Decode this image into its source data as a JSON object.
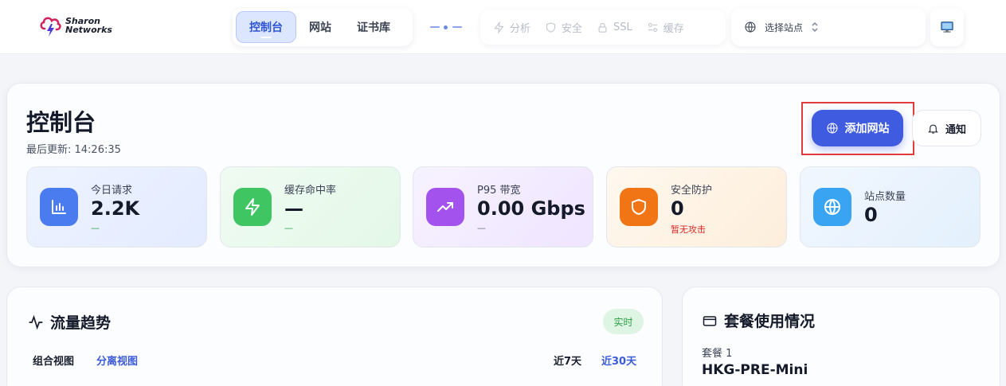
{
  "brand": {
    "line1": "Sharon",
    "line2": "Networks"
  },
  "nav": {
    "tabs": [
      {
        "label": "控制台"
      },
      {
        "label": "网站"
      },
      {
        "label": "证书库"
      }
    ]
  },
  "tools": [
    {
      "label": "分析",
      "icon": "lightning-icon"
    },
    {
      "label": "安全",
      "icon": "shield-icon"
    },
    {
      "label": "SSL",
      "icon": "lock-icon"
    },
    {
      "label": "缓存",
      "icon": "sliders-icon"
    }
  ],
  "site_select": {
    "placeholder": "选择站点"
  },
  "header": {
    "title": "控制台",
    "last_update": "最后更新: 14:26:35"
  },
  "actions": {
    "add_site": "添加网站",
    "notify": "通知"
  },
  "stats": [
    {
      "label": "今日请求",
      "value": "2.2K",
      "sub": "—",
      "color": "#4a7cf0"
    },
    {
      "label": "缓存命中率",
      "value": "—",
      "sub": "—",
      "color": "#3fc561"
    },
    {
      "label": "P95 带宽",
      "value": "0.00 Gbps",
      "sub": "—",
      "color": "#a452ee"
    },
    {
      "label": "安全防护",
      "value": "0",
      "sub": "暂无攻击",
      "color": "#f27515"
    },
    {
      "label": "站点数量",
      "value": "0",
      "color": "#38a4f2"
    }
  ],
  "traffic": {
    "title": "流量趋势",
    "badge": "实时",
    "views": [
      "组合视图",
      "分离视图"
    ],
    "ranges": [
      "近7天",
      "近30天"
    ]
  },
  "plan": {
    "title": "套餐使用情况",
    "label": "套餐 1",
    "name": "HKG-PRE-Mini"
  }
}
